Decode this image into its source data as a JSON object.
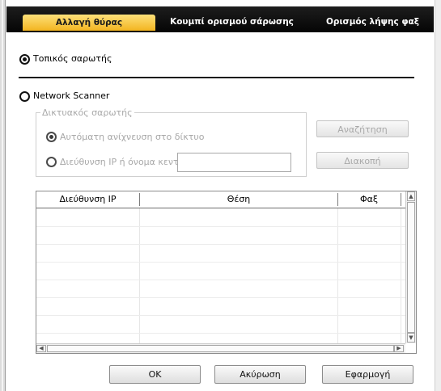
{
  "tabs": [
    {
      "label": "Αλλαγή θύρας",
      "active": true
    },
    {
      "label": "Κουμπί ορισμού σάρωσης",
      "active": false
    },
    {
      "label": "Ορισμός λήψης φαξ",
      "active": false
    }
  ],
  "local_scanner": {
    "label": "Τοπικός σαρωτής",
    "selected": true
  },
  "network_scanner": {
    "label": "Network Scanner",
    "selected": false
  },
  "network_group": {
    "legend": "Δικτυακός σαρωτής",
    "auto_detect_label": "Αυτόματη ανίχνευση στο δίκτυο",
    "ip_label": "Διεύθυνση IP ή όνομα κεντρικ",
    "ip_value": ""
  },
  "buttons": {
    "search": "Αναζήτηση",
    "stop": "Διακοπή",
    "ok": "OK",
    "cancel": "Ακύρωση",
    "apply": "Εφαρμογή"
  },
  "table": {
    "columns": [
      "Διεύθυνση IP",
      "Θέση",
      "Φαξ"
    ],
    "rows": []
  },
  "colors": {
    "tab_bar": "#0d0d0d",
    "active_tab": "#f5c02f",
    "disabled_text": "#a8a8a8"
  }
}
